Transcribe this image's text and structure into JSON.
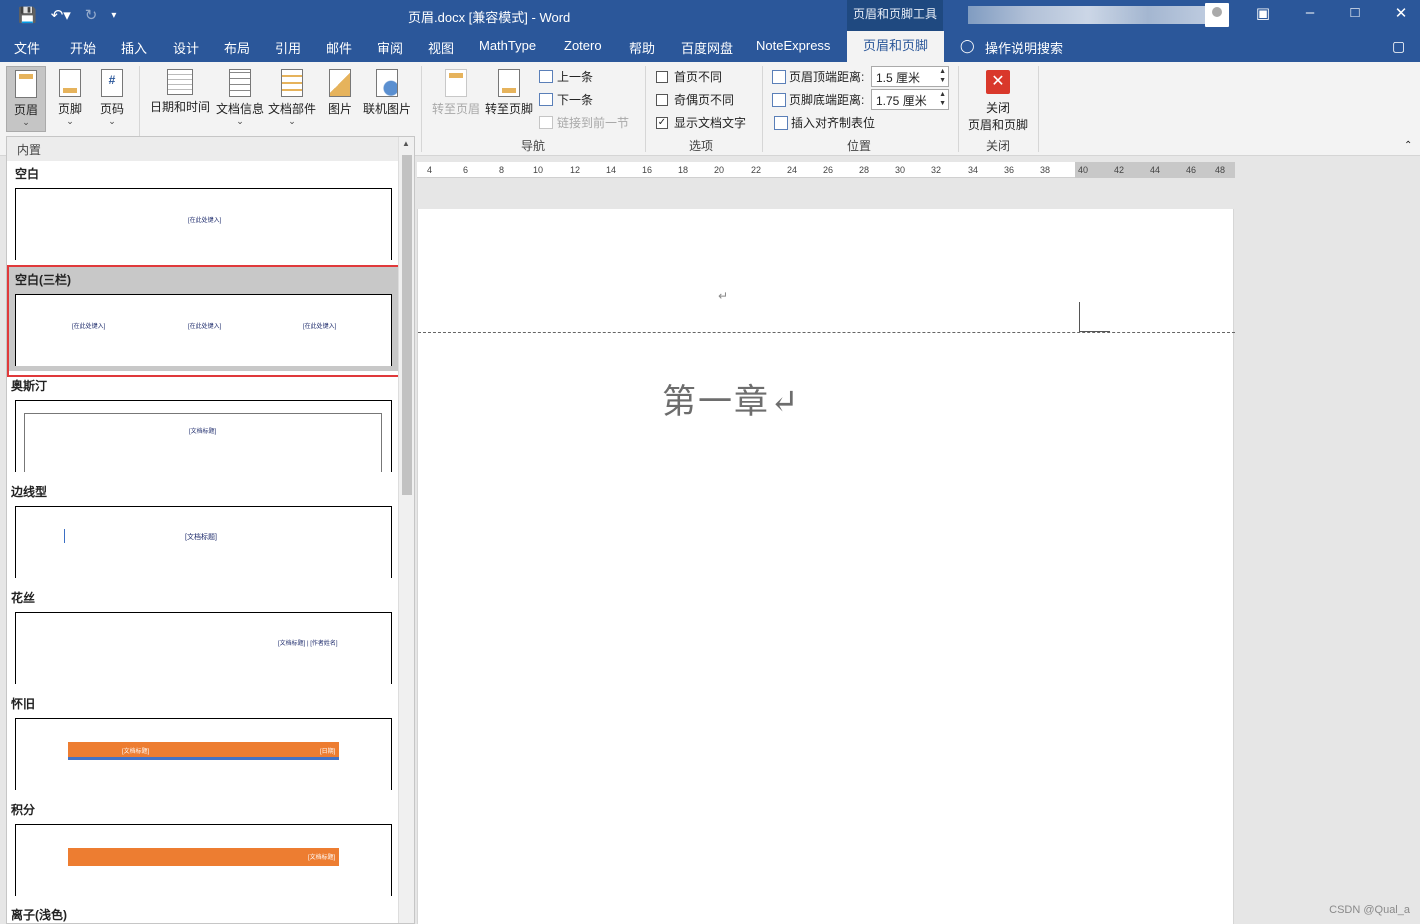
{
  "title_bar": {
    "document_title": "页眉.docx [兼容模式]  -  Word",
    "context_tab_group": "页眉和页脚工具",
    "qat": {
      "save_icon": "save-icon",
      "undo_icon": "undo-icon",
      "redo_icon": "redo-icon",
      "customize_icon": "customize-qat-icon"
    },
    "window_controls": [
      "ribbon-display-icon",
      "minimize-icon",
      "maximize-icon",
      "close-icon"
    ]
  },
  "tabs": [
    "文件",
    "开始",
    "插入",
    "设计",
    "布局",
    "引用",
    "邮件",
    "审阅",
    "视图",
    "MathType",
    "Zotero",
    "帮助",
    "百度网盘",
    "NoteExpress",
    "页眉和页脚"
  ],
  "tell_me": "操作说明搜索",
  "ribbon": {
    "header_footer_group": {
      "header": "页眉",
      "footer": "页脚",
      "page_number": "页码"
    },
    "insert_group": {
      "date_time": "日期和时间",
      "doc_info": "文档信息",
      "doc_parts": "文档部件",
      "picture": "图片",
      "online_picture": "联机图片"
    },
    "navigation": {
      "goto_header": "转至页眉",
      "goto_footer": "转至页脚",
      "previous": "上一条",
      "next": "下一条",
      "link_previous": "链接到前一节",
      "label": "导航"
    },
    "options": {
      "different_first": "首页不同",
      "different_odd_even": "奇偶页不同",
      "show_doc_text": "显示文档文字",
      "show_doc_text_checked": true,
      "label": "选项"
    },
    "position": {
      "header_from_top_label": "页眉顶端距离:",
      "header_from_top_value": "1.5 厘米",
      "footer_from_bottom_label": "页脚底端距离:",
      "footer_from_bottom_value": "1.75 厘米",
      "insert_alignment_tab": "插入对齐制表位",
      "label": "位置"
    },
    "close": {
      "line1": "关闭",
      "line2": "页眉和页脚",
      "label": "关闭"
    }
  },
  "gallery": {
    "section_header": "内置",
    "items": [
      {
        "name": "空白",
        "placeholders": [
          "[在此处键入]"
        ]
      },
      {
        "name": "空白(三栏)",
        "placeholders": [
          "[在此处键入]",
          "[在此处键入]",
          "[在此处键入]"
        ],
        "selected": true
      },
      {
        "name": "奥斯汀",
        "placeholders": [
          "[文档标题]"
        ]
      },
      {
        "name": "边线型",
        "placeholders": [
          "[文档标题]"
        ]
      },
      {
        "name": "花丝",
        "placeholders": [
          "[文档标题] | [作者姓名]"
        ]
      },
      {
        "name": "怀旧",
        "placeholders": [
          "[文档标题]",
          "[日期]"
        ]
      },
      {
        "name": "积分",
        "placeholders": [
          "[文档标题]"
        ]
      },
      {
        "name": "离子(浅色)",
        "placeholders": []
      }
    ]
  },
  "ruler": {
    "ticks": [
      "4",
      "6",
      "8",
      "10",
      "12",
      "14",
      "16",
      "18",
      "20",
      "22",
      "24",
      "26",
      "28",
      "30",
      "32",
      "34",
      "36",
      "38",
      "40",
      "42",
      "44",
      "46",
      "48"
    ]
  },
  "document": {
    "header_paragraph_mark": "↵",
    "heading": "第一章↵"
  },
  "watermark": "CSDN @Qual_a",
  "colors": {
    "accent": "#2b579a",
    "close_red": "#d9382b",
    "highlight_red": "#e0393b",
    "orange": "#ed7d31"
  }
}
